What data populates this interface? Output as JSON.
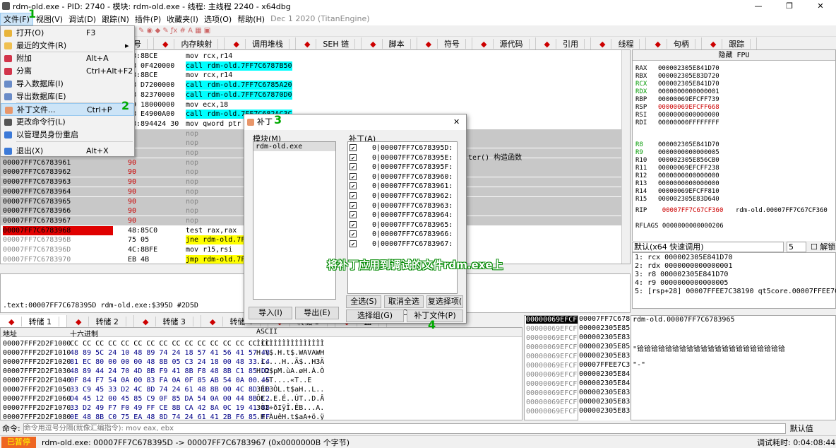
{
  "window": {
    "title": "rdm-old.exe - PID: 2740 - 模块: rdm-old.exe - 线程: 主线程 2240 - x64dbg"
  },
  "menu": [
    "文件(F)",
    "视图(V)",
    "调试(D)",
    "跟踪(N)",
    "插件(P)",
    "收藏夹(I)",
    "选项(O)",
    "帮助(H)",
    "Dec 1 2020 (TitanEngine)"
  ],
  "tabs_top": [
    "符号",
    "内存映射",
    "调用堆栈",
    "SEH 链",
    "脚本",
    "符号",
    "源代码",
    "引用",
    "线程",
    "句柄",
    "跟踪"
  ],
  "cpu_rows": [
    {
      "addr": "",
      "bytes": "48:8BCE",
      "asm": "mov rcx,r14",
      "hl": ""
    },
    {
      "addr": "",
      "bytes": "E8 0F420000",
      "asm": "call rdm-old.7FF7C6787B50",
      "hl": "call"
    },
    {
      "addr": "",
      "bytes": "48:8BCE",
      "asm": "mov rcx,r14",
      "hl": ""
    },
    {
      "addr": "",
      "bytes": "E8 D7200000",
      "asm": "call rdm-old.7FF7C6785A20",
      "hl": "call"
    },
    {
      "addr": "",
      "bytes": "E8 82370000",
      "asm": "call rdm-old.7FF7C67870D0",
      "hl": "call"
    },
    {
      "addr": "",
      "bytes": "B9 18000000",
      "asm": "mov ecx,18",
      "hl": ""
    },
    {
      "addr": "",
      "bytes": "E8 E4900A00",
      "asm": "call rdm-old.7FF7C682AC3C",
      "hl": "call"
    },
    {
      "addr": "",
      "bytes": "48:894424 30",
      "asm": "mov qword ptr ss:[rsp+30],rax",
      "hl": ""
    },
    {
      "addr": "",
      "bytes": "",
      "asm": "nop",
      "hl": "grey"
    },
    {
      "addr": "",
      "bytes": "",
      "asm": "nop",
      "hl": "grey"
    },
    {
      "addr": "",
      "bytes": "",
      "asm": "nop",
      "hl": "grey"
    },
    {
      "addr": "00007FF7C6783961",
      "bytes": "90",
      "asm": "nop",
      "hl": "grey"
    },
    {
      "addr": "00007FF7C6783962",
      "bytes": "90",
      "asm": "nop",
      "hl": "grey"
    },
    {
      "addr": "00007FF7C6783963",
      "bytes": "90",
      "asm": "nop",
      "hl": "grey"
    },
    {
      "addr": "00007FF7C6783964",
      "bytes": "90",
      "asm": "nop",
      "hl": "grey"
    },
    {
      "addr": "00007FF7C6783965",
      "bytes": "90",
      "asm": "nop",
      "hl": "grey"
    },
    {
      "addr": "00007FF7C6783966",
      "bytes": "90",
      "asm": "nop",
      "hl": "grey"
    },
    {
      "addr": "00007FF7C6783967",
      "bytes": "90",
      "asm": "nop",
      "hl": "grey"
    },
    {
      "addr": "00007FF7C6783968",
      "bytes": "48:85C0",
      "asm": "test rax,rax",
      "hl": "sel"
    },
    {
      "addr": "00007FF7C678396B",
      "bytes": "75 05",
      "asm": "jne rdm-old.7FF7C6783972",
      "hl": "jmp"
    },
    {
      "addr": "00007FF7C678396D",
      "bytes": "4C:8BFE",
      "asm": "mov r15,rsi",
      "hl": ""
    },
    {
      "addr": "00007FF7C6783970",
      "bytes": "EB 4B",
      "asm": "jmp rdm-old.7FF7C67839BD",
      "hl": "jmp"
    }
  ],
  "cpu_comment": "ter() 构造函数",
  "regs": {
    "header": "隐藏 FPU",
    "list": [
      [
        "RAX",
        "000002305E841D70",
        ""
      ],
      [
        "RBX",
        "000002305E83D720",
        ""
      ],
      [
        "RCX",
        "000002305E841D70",
        "g"
      ],
      [
        "RDX",
        "0000000000000001",
        "g"
      ],
      [
        "RBP",
        "00000069EFCFF739",
        ""
      ],
      [
        "RSP",
        "00000069EFCFF668",
        "r"
      ],
      [
        "RSI",
        "0000000000000000",
        ""
      ],
      [
        "RDI",
        "00000000FFFFFFFF",
        ""
      ],
      [
        "R8",
        "000002305E841D70",
        "g"
      ],
      [
        "R9",
        "0000000000000005",
        "g"
      ],
      [
        "R10",
        "000002305E856CB0",
        ""
      ],
      [
        "R11",
        "00000069EFCFF238",
        ""
      ],
      [
        "R12",
        "0000000000000000",
        ""
      ],
      [
        "R13",
        "0000000000000000",
        ""
      ],
      [
        "R14",
        "00000069EFCFF810",
        ""
      ],
      [
        "R15",
        "000002305E83D640",
        ""
      ]
    ],
    "rip": "00007FF7C67CF360",
    "rip_cmt": "rdm-old.00007FF7C67CF360",
    "rflags": "RFLAGS  0000000000000206"
  },
  "callconv": {
    "label": "默认(x64 快速调用)",
    "count": "5",
    "unlock": "解锁"
  },
  "stack_args": [
    "1: rcx 000002305E841D70",
    "2: rdx 0000000000000001",
    "3: r8 000002305E841D70",
    "4: r9 0000000000000005",
    "5: [rsp+28] 00007FFEE7C38190 qt5core.00007FFEE7C38"
  ],
  "info_line": ".text:00007FF7C678395D rdm-old.exe:$395D #2D5D",
  "tabs_bottom": [
    "转储 1",
    "转储 2",
    "转储 3",
    "转储 4",
    "转储 5",
    "监"
  ],
  "dump": {
    "h_addr": "地址",
    "h_hex": "十六进制",
    "h_ascii": "ASCII",
    "rows": [
      [
        "00007FFF2D2F1000",
        "CC CC CC CC CC CC CC CC CC CC CC CC CC CC CC CC",
        "ÌÌÌÌÌÌÌÌÌÌÌÌÌÌÌÌ"
      ],
      [
        "00007FFF2D2F1010",
        "48 89 5C 24 10 48 89 74 24 18 57 41 56 41 57 48",
        "H.\\$.H.t$.WAVAWH"
      ],
      [
        "00007FFF2D2F1020",
        "81 EC 80 00 00 00 48 8B 05 C3 24 18 00 48 33 C4",
        ".ì....H..Ã$..H3Ä"
      ],
      [
        "00007FFF2D2F1030",
        "48 89 44 24 70 4D 8B F9 41 8B F8 48 8B C1 85 D2",
        "H.D$pM.ùA.øH.Á.Ò"
      ],
      [
        "00007FFF2D2F1040",
        "0F 84 F7 54 0A 00 83 FA 0A 0F 85 AB 54 0A 00 45",
        "..÷T....«T..E"
      ],
      [
        "00007FFF2D2F1050",
        "33 C9 45 33 D2 4C 8D 74 24 61 48 8B 00 4C 8D 1D",
        "3ÉE3ÒL.t$aH..L.."
      ],
      [
        "00007FFF2D2F1060",
        "D4 45 12 00 45 85 C9 0F 85 DA 54 0A 00 44 8B C2",
        "ÔE..E.É..ÚT..D.Â"
      ],
      [
        "00007FFF2D2F1070",
        "33 D2 49 F7 F0 49 FF CE 8B CA 42 8A 0C 19 41 88",
        "3ÒI÷ðIÿÎ.ÊB...A."
      ],
      [
        "00007FFF2D2F1080",
        "0E 48 8B C0 75 EA 48 8D 74 24 61 41 2B F6 85 FF",
        ".H.ÀuêH.t$aA+ö.ÿ"
      ]
    ]
  },
  "stack": {
    "rows": [
      "00000069EFCFF",
      "00000069EFCFF",
      "00000069EFCFF",
      "00000069EFCFF",
      "00000069EFCFF",
      "00000069EFCFF",
      "00000069EFCFF",
      "00000069EFCFF",
      "00000069EFCFF",
      "00000069EFCFF",
      "00000069EFCFF"
    ],
    "vals": [
      "00007FF7C6783",
      "000002305E856",
      "000002305E83D",
      "000002305E856",
      "000002305E83D",
      "00007FFEE7C3E",
      "000002305E841",
      "000002305E841",
      "000002305E83D",
      "000002305E83D",
      "000002305E83D"
    ],
    "comments": [
      "rdm-old.00007FF7C6783965",
      "",
      "\"铪铪铪铪铪铪铪铪铪铪铪铪铪铪铪铪铪铪铪铪铪",
      "",
      "\"-\""
    ]
  },
  "cmd": {
    "label": "命令:",
    "placeholder": "命令用逗号分隔(就像汇编指令): mov eax, ebx",
    "default": "默认值"
  },
  "status": {
    "paused": "已暂停",
    "text": "rdm-old.exe: 00007FF7C678395D -> 00007FF7C6783967 (0x0000000B 个字节)",
    "time": "调试耗时: 0:04:08:44"
  },
  "filemenu": [
    {
      "label": "打开(O)",
      "sc": "F3",
      "icon": "#e8b43a"
    },
    {
      "label": "最近的文件(R)",
      "sc": "",
      "icon": "#f0c050",
      "arrow": "▸"
    },
    {
      "label": "附加",
      "sc": "Alt+A",
      "icon": "#d2354b"
    },
    {
      "label": "分离",
      "sc": "Ctrl+Alt+F2",
      "icon": "#d2354b"
    },
    {
      "label": "导入数据库(I)",
      "sc": "",
      "icon": "#6a8cc8"
    },
    {
      "label": "导出数据库(E)",
      "sc": "",
      "icon": "#6a8cc8"
    },
    {
      "label": "补丁文件...",
      "sc": "Ctrl+P",
      "icon": "#e8966a"
    },
    {
      "label": "更改命令行(L)",
      "sc": "",
      "icon": "#555"
    },
    {
      "label": "以管理员身份重启",
      "sc": "",
      "icon": "#3c7ad8"
    },
    {
      "label": "退出(X)",
      "sc": "Alt+X",
      "icon": "#3c7ad8"
    }
  ],
  "dialog": {
    "title": "补丁",
    "modules_label": "模块(M)",
    "module": "rdm-old.exe",
    "patches_label": "补丁(A)",
    "patches": [
      "0|00007FF7C678395D:",
      "0|00007FF7C678395E:",
      "0|00007FF7C678395F:",
      "0|00007FF7C6783960:",
      "0|00007FF7C6783961:",
      "0|00007FF7C6783962:",
      "0|00007FF7C6783963:",
      "0|00007FF7C6783964:",
      "0|00007FF7C6783965:",
      "0|00007FF7C6783966:",
      "0|00007FF7C6783967:"
    ],
    "import": "导入(I)",
    "export": "导出(E)",
    "select_all": "全选(S)",
    "deselect_all": "取消全选(D",
    "restore_sel": "复选择项(",
    "select_group": "选择组(G)",
    "patch_file": "补丁文件(P)"
  },
  "annotations": {
    "n1": "1",
    "n2": "2",
    "n3": "3",
    "n4": "4",
    "caption": "将补丁应用到调试的文件rdm.exe上"
  }
}
